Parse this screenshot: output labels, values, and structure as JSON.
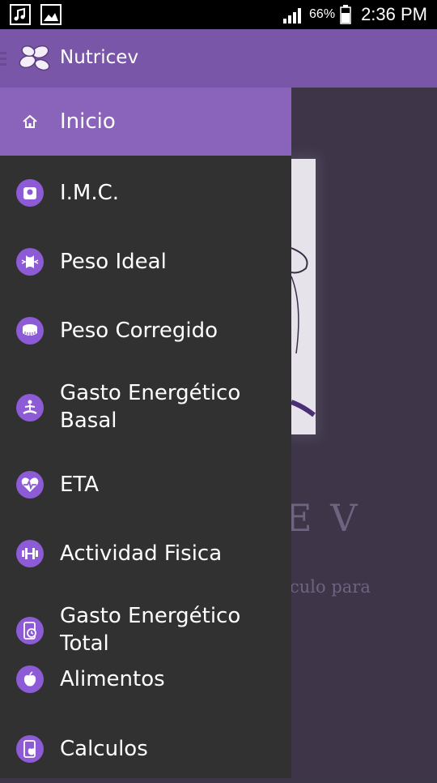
{
  "status_bar": {
    "battery_percent": "66%",
    "time": "2:36 PM",
    "icons": [
      "music-note-icon",
      "image-icon",
      "signal-icon",
      "battery-icon"
    ]
  },
  "app_bar": {
    "title": "Nutricev",
    "logo_icon": "petals-logo-icon",
    "menu_icon": "hamburger-icon"
  },
  "background_screen": {
    "heading_fragment": "E V",
    "subtext_fragment": "culo para"
  },
  "drawer": {
    "items": [
      {
        "label": "Inicio",
        "icon": "home-icon",
        "active": true
      },
      {
        "label": "I.M.C.",
        "icon": "scale-icon"
      },
      {
        "label": "Peso Ideal",
        "icon": "body-icon"
      },
      {
        "label": "Peso Corregido",
        "icon": "tape-measure-icon"
      },
      {
        "label_line1": "Gasto Energético",
        "label_line2": "Basal",
        "icon": "meditation-icon"
      },
      {
        "label": "ETA",
        "icon": "heartbeat-icon"
      },
      {
        "label": "Actividad Fisica",
        "icon": "dumbbell-icon"
      },
      {
        "label_line1": "Gasto Energético",
        "label_line2": "Total",
        "icon": "phone-timer-icon"
      },
      {
        "label": "Alimentos",
        "icon": "apple-icon"
      },
      {
        "label": "Calculos",
        "icon": "phone-apple-icon"
      }
    ]
  },
  "colors": {
    "app_bar": "#7a56a8",
    "active_item": "#8a63ba",
    "drawer_bg": "#313131",
    "icon_circle": "#8d5bd6"
  }
}
